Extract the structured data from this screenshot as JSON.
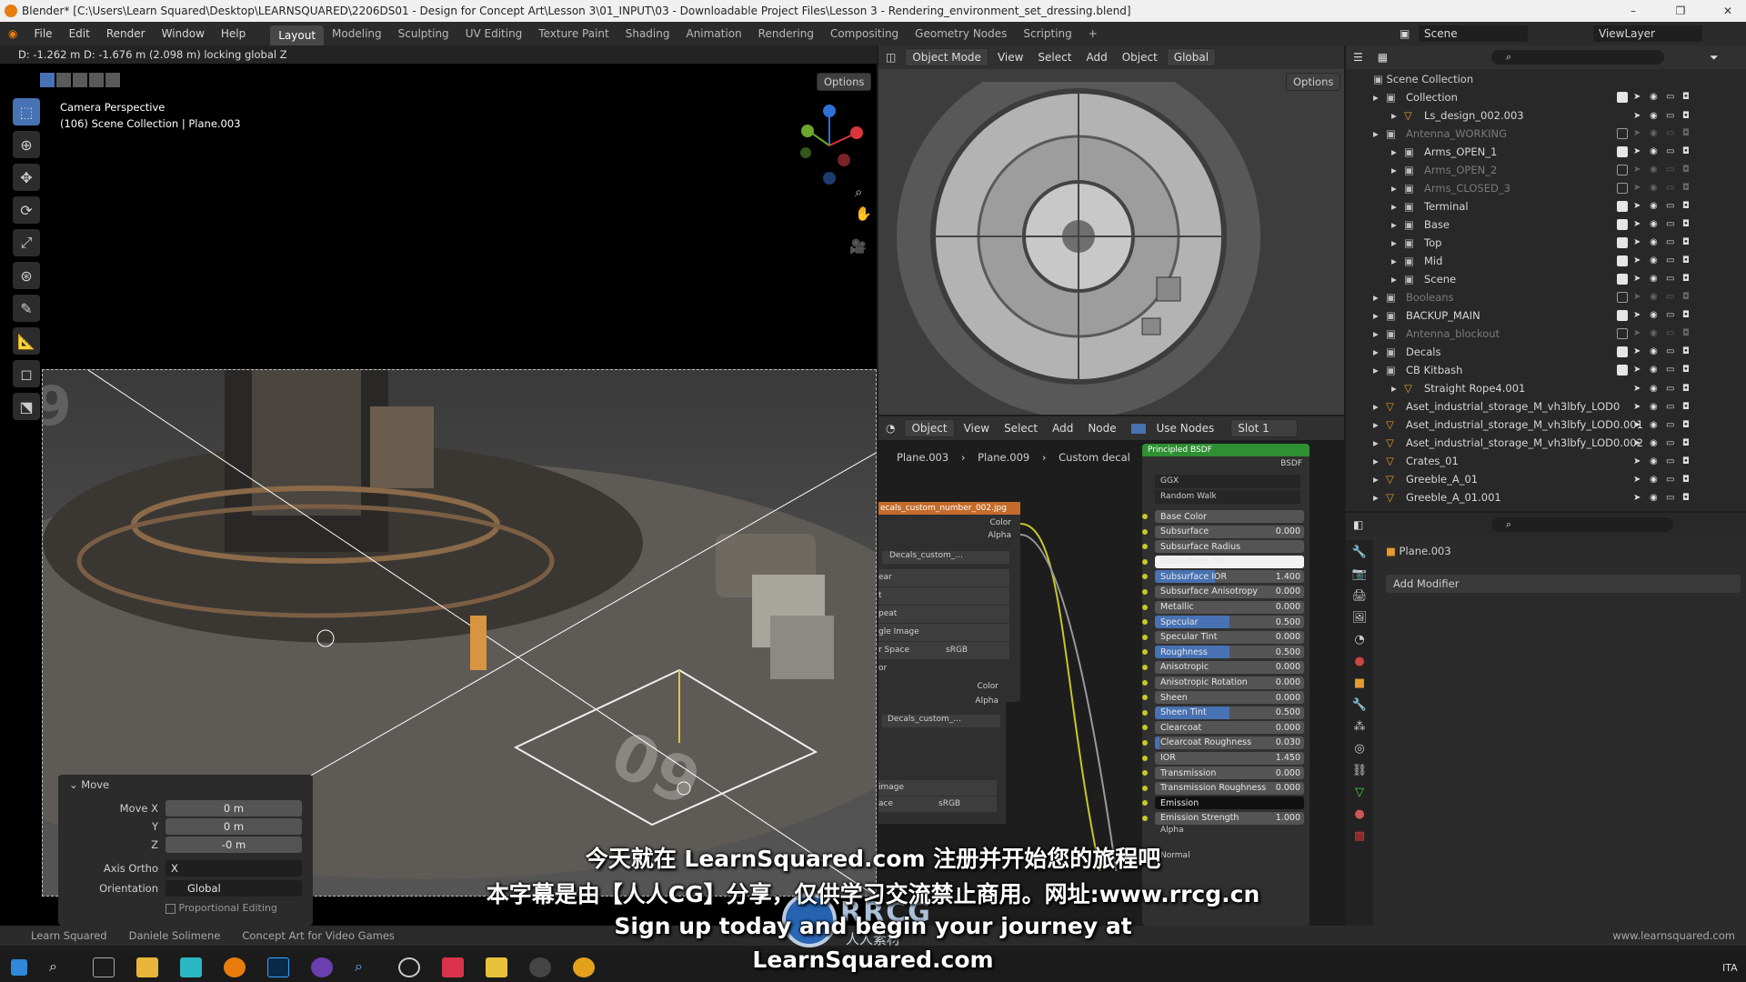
{
  "window": {
    "title": "Blender* [C:\\Users\\Learn Squared\\Desktop\\LEARNSQUARED\\2206DS01 - Design for Concept Art\\Lesson 3\\01_INPUT\\03 - Downloadable Project Files\\Lesson 3 - Rendering_environment_set_dressing.blend]",
    "minimize": "–",
    "maximize": "❐",
    "close": "✕"
  },
  "menu": {
    "items": [
      "File",
      "Edit",
      "Render",
      "Window",
      "Help"
    ],
    "workspaces": [
      "Layout",
      "Modeling",
      "Sculpting",
      "UV Editing",
      "Texture Paint",
      "Shading",
      "Animation",
      "Rendering",
      "Compositing",
      "Geometry Nodes",
      "Scripting"
    ],
    "active_workspace": "Layout",
    "add_tab": "+",
    "scene_label": "Scene",
    "viewlayer_label": "ViewLayer"
  },
  "viewport_main": {
    "header_text": "D: -1.262 m  D: -1.676 m (2.098 m) locking global Z",
    "options": "Options",
    "camera_label": "Camera Perspective",
    "collection_label": "(106) Scene Collection | Plane.003"
  },
  "viewport_right": {
    "mode": "Object Mode",
    "menu": [
      "View",
      "Select",
      "Add",
      "Object"
    ],
    "orientation": "Global",
    "options": "Options"
  },
  "move_panel": {
    "title": "Move",
    "move_x_label": "Move X",
    "move_x": "0 m",
    "y_label": "Y",
    "y": "0 m",
    "z_label": "Z",
    "z": "-0 m",
    "axis_ortho_label": "Axis Ortho",
    "axis_ortho": "X",
    "orientation_label": "Orientation",
    "orientation": "Global",
    "proportional": "Proportional Editing"
  },
  "node_editor": {
    "type": "Object",
    "menu": [
      "View",
      "Select",
      "Add",
      "Node"
    ],
    "use_nodes": "Use Nodes",
    "slot": "Slot 1",
    "breadcrumb": [
      "Plane.003",
      "Plane.009",
      "Custom decal"
    ],
    "image_node_title": "ecals_custom_number_002.jpg",
    "color": "Color",
    "alpha": "Alpha",
    "image_field": "Decals_custom_...",
    "image_field2": "Decals_custom_...",
    "rows1": [
      "ear",
      "t",
      "peat",
      "gle Image",
      "r Space",
      "or"
    ],
    "srgb": "sRGB",
    "rows2": [
      "image",
      "ace"
    ],
    "bsdf_title": "Principled BSDF",
    "bsdf_out": "BSDF",
    "distribution": "GGX",
    "subsurface_method": "Random Walk",
    "props": [
      {
        "label": "Base Color",
        "value": "",
        "fill": 0
      },
      {
        "label": "Subsurface",
        "value": "0.000",
        "fill": 0
      },
      {
        "label": "Subsurface Radius",
        "value": "",
        "fill": 0
      },
      {
        "label": "Subsurface Col",
        "value": "",
        "fill": 0
      },
      {
        "label": "Subsurface IOR",
        "value": "1.400",
        "fill": 0.4
      },
      {
        "label": "Subsurface Anisotropy",
        "value": "0.000",
        "fill": 0
      },
      {
        "label": "Metallic",
        "value": "0.000",
        "fill": 0
      },
      {
        "label": "Specular",
        "value": "0.500",
        "fill": 0.5
      },
      {
        "label": "Specular Tint",
        "value": "0.000",
        "fill": 0
      },
      {
        "label": "Roughness",
        "value": "0.500",
        "fill": 0.5
      },
      {
        "label": "Anisotropic",
        "value": "0.000",
        "fill": 0
      },
      {
        "label": "Anisotropic Rotation",
        "value": "0.000",
        "fill": 0
      },
      {
        "label": "Sheen",
        "value": "0.000",
        "fill": 0
      },
      {
        "label": "Sheen Tint",
        "value": "0.500",
        "fill": 0.5
      },
      {
        "label": "Clearcoat",
        "value": "0.000",
        "fill": 0
      },
      {
        "label": "Clearcoat Roughness",
        "value": "0.030",
        "fill": 0.03
      },
      {
        "label": "IOR",
        "value": "1.450",
        "fill": 0
      },
      {
        "label": "Transmission",
        "value": "0.000",
        "fill": 0
      },
      {
        "label": "Transmission Roughness",
        "value": "0.000",
        "fill": 0
      },
      {
        "label": "Emission",
        "value": "",
        "fill": 0
      },
      {
        "label": "Emission Strength",
        "value": "1.000",
        "fill": 0
      }
    ],
    "alpha_label": "Alpha",
    "normal_label": "Normal"
  },
  "outliner": {
    "root": "Scene Collection",
    "rows": [
      {
        "name": "Collection",
        "indent": 0,
        "dim": false,
        "checked": true
      },
      {
        "name": "Ls_design_002.003",
        "indent": 1,
        "dim": false,
        "checked": null
      },
      {
        "name": "Antenna_WORKING",
        "indent": 0,
        "dim": true,
        "checked": false
      },
      {
        "name": "Arms_OPEN_1",
        "indent": 1,
        "dim": false,
        "checked": true
      },
      {
        "name": "Arms_OPEN_2",
        "indent": 1,
        "dim": true,
        "checked": false
      },
      {
        "name": "Arms_CLOSED_3",
        "indent": 1,
        "dim": true,
        "checked": false
      },
      {
        "name": "Terminal",
        "indent": 1,
        "dim": false,
        "checked": true
      },
      {
        "name": "Base",
        "indent": 1,
        "dim": false,
        "checked": true
      },
      {
        "name": "Top",
        "indent": 1,
        "dim": false,
        "checked": true
      },
      {
        "name": "Mid",
        "indent": 1,
        "dim": false,
        "checked": true
      },
      {
        "name": "Scene",
        "indent": 1,
        "dim": false,
        "checked": true
      },
      {
        "name": "Booleans",
        "indent": 0,
        "dim": true,
        "checked": false
      },
      {
        "name": "BACKUP_MAIN",
        "indent": 0,
        "dim": false,
        "checked": true
      },
      {
        "name": "Antenna_blockout",
        "indent": 0,
        "dim": true,
        "checked": false
      },
      {
        "name": "Decals",
        "indent": 0,
        "dim": false,
        "checked": true
      },
      {
        "name": "CB Kitbash",
        "indent": 0,
        "dim": false,
        "checked": true
      },
      {
        "name": "Straight Rope4.001",
        "indent": 1,
        "dim": false,
        "checked": null
      },
      {
        "name": "Aset_industrial_storage_M_vh3lbfy_LOD0",
        "indent": 0,
        "dim": false,
        "checked": null
      },
      {
        "name": "Aset_industrial_storage_M_vh3lbfy_LOD0.001",
        "indent": 0,
        "dim": false,
        "checked": null
      },
      {
        "name": "Aset_industrial_storage_M_vh3lbfy_LOD0.002",
        "indent": 0,
        "dim": false,
        "checked": null
      },
      {
        "name": "Crates_01",
        "indent": 0,
        "dim": false,
        "checked": null
      },
      {
        "name": "Greeble_A_01",
        "indent": 0,
        "dim": false,
        "checked": null
      },
      {
        "name": "Greeble_A_01.001",
        "indent": 0,
        "dim": false,
        "checked": null
      }
    ]
  },
  "properties": {
    "object": "Plane.003",
    "add_modifier": "Add Modifier"
  },
  "statusbar": {
    "items": [
      "Learn Squared",
      "Daniele Solimene",
      "Concept Art for Video Games"
    ],
    "website": "www.learnsquared.com"
  },
  "subtitles": {
    "line1": "今天就在 LearnSquared.com 注册并开始您的旅程吧",
    "line2": "本字幕是由【人人CG】分享，仅供学习交流禁止商用。网址:www.rrcg.cn",
    "line3": "Sign up today and begin your journey at",
    "line4": "LearnSquared.com"
  },
  "watermark": {
    "logo": "RRCG",
    "sub": "人人素材"
  },
  "taskbar": {
    "lang": "ITA"
  },
  "colors": {
    "accent": "#4772b3",
    "node_header_image": "#c46b2b",
    "node_header_shader": "#2e8f33",
    "socket_yellow": "#c7c729"
  }
}
